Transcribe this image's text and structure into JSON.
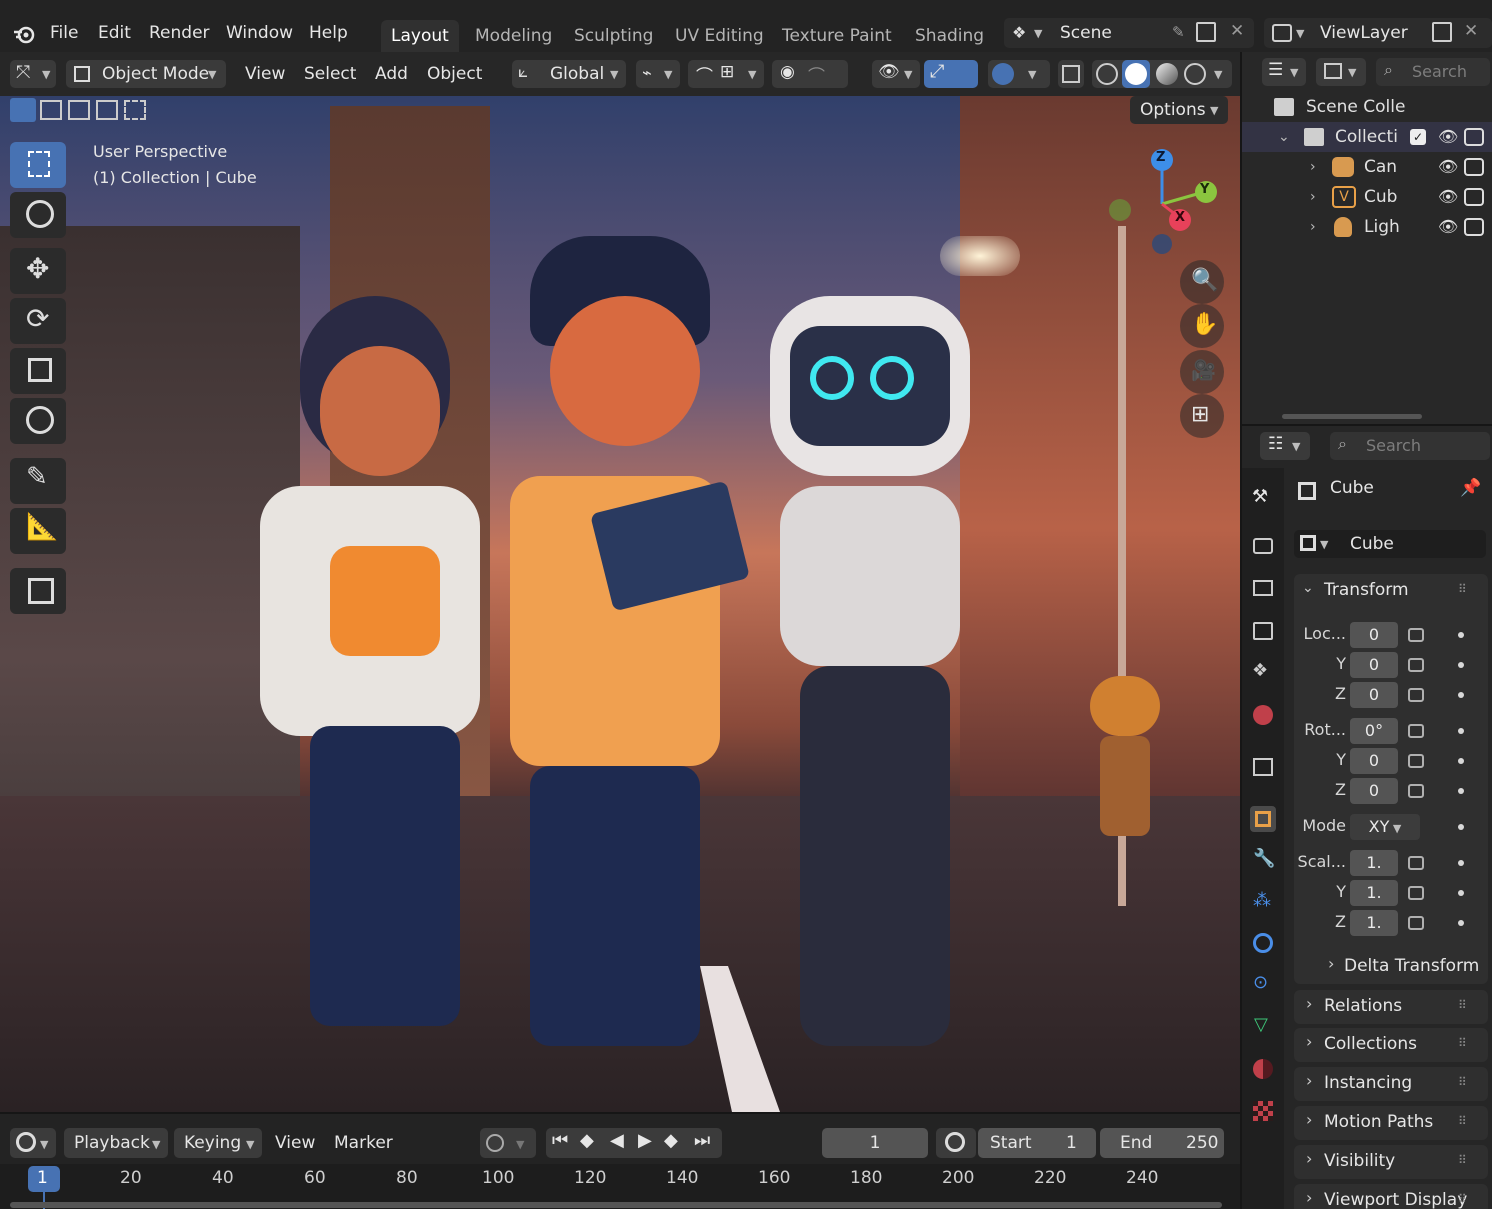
{
  "topbar": {
    "menus": [
      "File",
      "Edit",
      "Render",
      "Window",
      "Help"
    ],
    "workspaces": [
      "Layout",
      "Modeling",
      "Sculpting",
      "UV Editing",
      "Texture Paint",
      "Shading"
    ],
    "active_workspace": "Layout",
    "scene_name": "Scene",
    "view_layer": "ViewLayer"
  },
  "viewport_header": {
    "mode": "Object Mode",
    "menus": [
      "View",
      "Select",
      "Add",
      "Object"
    ],
    "orientation": "Global",
    "options_label": "Options"
  },
  "viewport": {
    "perspective_label": "User Perspective",
    "collection_label": "(1) Collection | Cube",
    "gizmo_axes": [
      "Z",
      "Y",
      "X"
    ]
  },
  "outliner": {
    "search_placeholder": "Search",
    "root": "Scene Colle",
    "collection": "Collecti",
    "items": [
      {
        "name": "Can",
        "icon": "camera-icon"
      },
      {
        "name": "Cub",
        "icon": "mesh-icon"
      },
      {
        "name": "Ligh",
        "icon": "light-icon"
      }
    ]
  },
  "properties": {
    "search_placeholder": "Search",
    "object_name": "Cube",
    "data_name": "Cube",
    "transform_title": "Transform",
    "location_label": "Loc...",
    "location": [
      "0",
      "0",
      "0"
    ],
    "rotation_label": "Rot...",
    "rotation": [
      "0°",
      "0",
      "0"
    ],
    "mode_label": "Mode",
    "mode_value": "XY",
    "scale_label": "Scal...",
    "scale": [
      "1.",
      "1.",
      "1."
    ],
    "axis_y": "Y",
    "axis_z": "Z",
    "delta_transform": "Delta Transform",
    "panels": [
      "Relations",
      "Collections",
      "Instancing",
      "Motion Paths",
      "Visibility",
      "Viewport Display"
    ]
  },
  "timeline": {
    "menus": [
      "Playback",
      "Keying",
      "View",
      "Marker"
    ],
    "current_frame": "1",
    "start_label": "Start",
    "start_value": "1",
    "end_label": "End",
    "end_value": "250",
    "ruler": [
      "1",
      "20",
      "40",
      "60",
      "80",
      "100",
      "120",
      "140",
      "160",
      "180",
      "200",
      "220",
      "240"
    ]
  },
  "colors": {
    "accent_blue": "#4772b3",
    "axis_x": "#e8415a",
    "axis_y": "#8bc53f",
    "axis_z": "#3d8ee8"
  }
}
